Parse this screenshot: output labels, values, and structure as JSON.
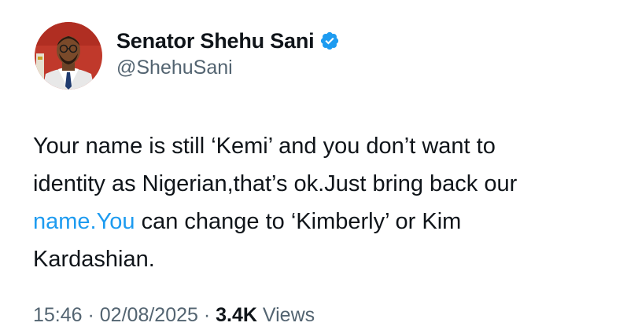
{
  "author": {
    "display_name": "Senator Shehu Sani",
    "handle": "@ShehuSani",
    "verified_color": "#1d9bf0"
  },
  "tweet": {
    "line1": "Your name is still ‘Kemi’ and you don’t want to",
    "line2": "identity as Nigerian,that’s ok.Just bring back our",
    "line3_link": "name.You",
    "line3_rest": " can change to ‘Kimberly’ or Kim",
    "line4": "Kardashian."
  },
  "meta": {
    "time": "15:46",
    "separator1": " · ",
    "date": "02/08/2025",
    "separator2": " · ",
    "views_count": "3.4K",
    "views_label": " Views"
  },
  "colors": {
    "link": "#1d9bf0",
    "secondary_text": "#536471",
    "primary_text": "#0f1419"
  }
}
